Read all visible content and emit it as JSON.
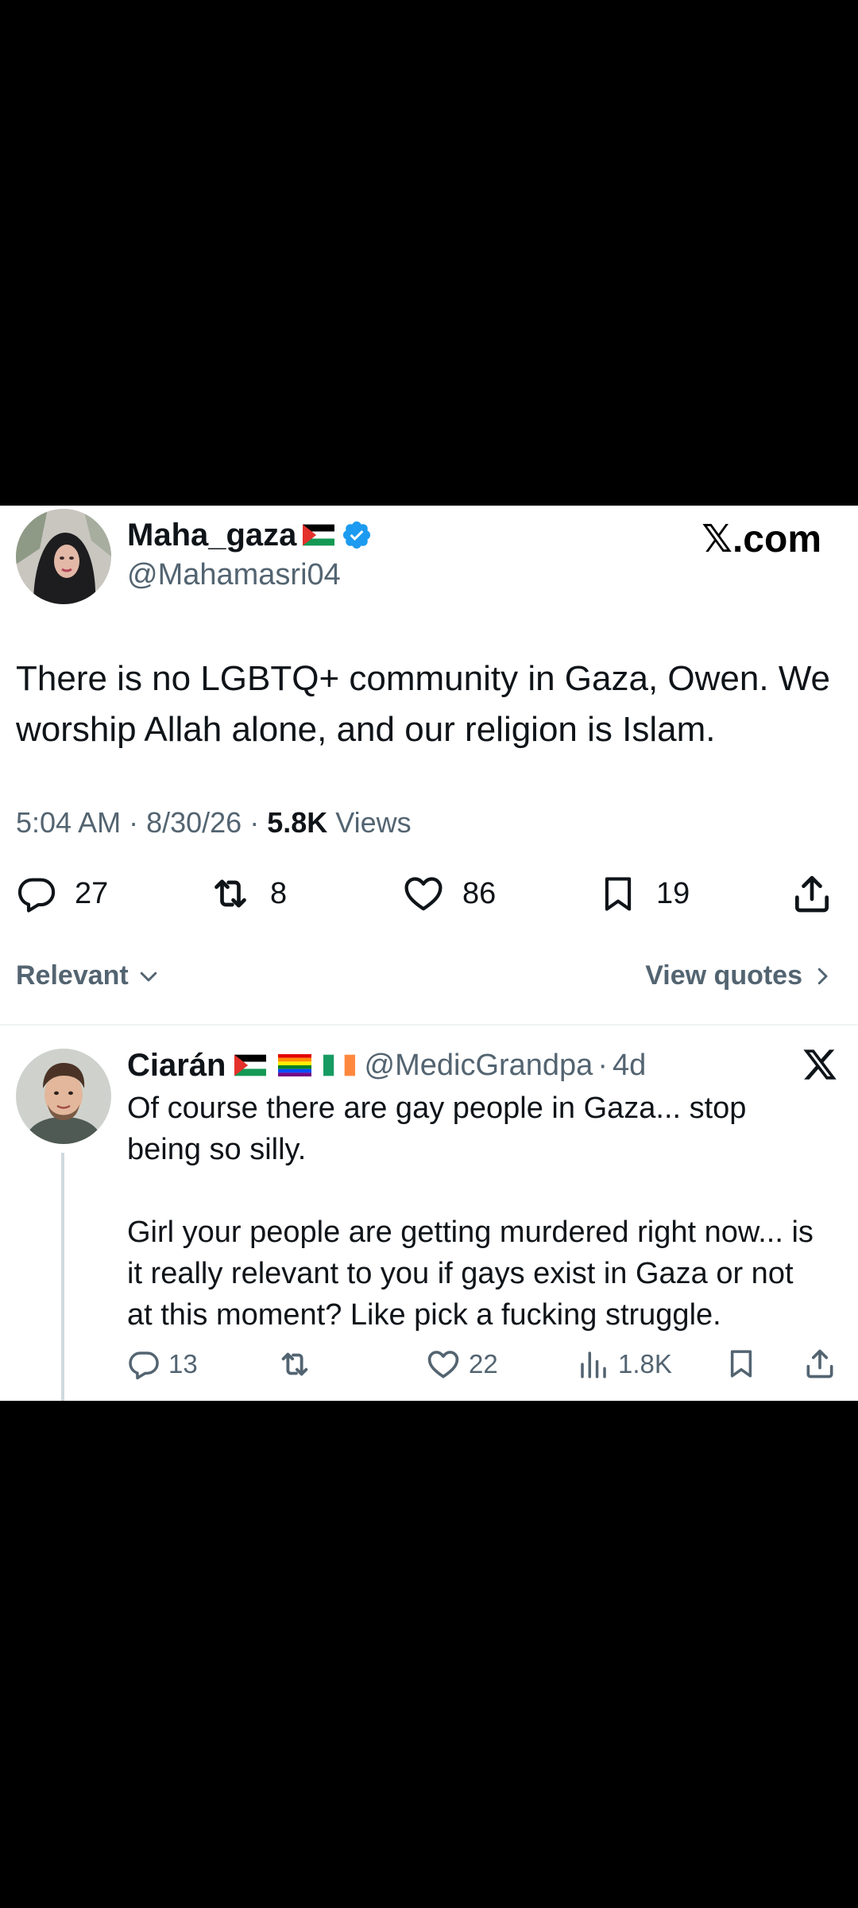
{
  "main_tweet": {
    "display_name": "Maha_gaza",
    "handle": "@Mahamasri04",
    "verified": true,
    "badge_color": "#1d9bf0",
    "site_label": "𝕏.com",
    "text": "There is no LGBTQ+ community in Gaza, Owen. We worship Allah alone, and our religion is Islam.",
    "time": "5:04 AM",
    "date": "8/30/26",
    "views_count": "5.8K",
    "views_label": "Views",
    "actions": {
      "replies": "27",
      "reposts": "8",
      "likes": "86",
      "bookmarks": "19"
    }
  },
  "filter": {
    "sort_label": "Relevant",
    "quotes_label": "View quotes"
  },
  "reply": {
    "display_name": "Ciarán",
    "handle": "@MedicGrandpa",
    "age": "4d",
    "text_part1": "Of course there are gay people in Gaza... stop being so silly.",
    "text_part2": "Girl your people are getting murdered right now... is it really relevant to you if gays exist in Gaza or not at this moment? Like pick a fucking struggle.",
    "actions": {
      "replies": "13",
      "likes": "22",
      "views": "1.8K"
    }
  },
  "colors": {
    "text": "#0f1419",
    "secondary": "#536471",
    "divider": "#eff3f4",
    "background": "#000000"
  }
}
